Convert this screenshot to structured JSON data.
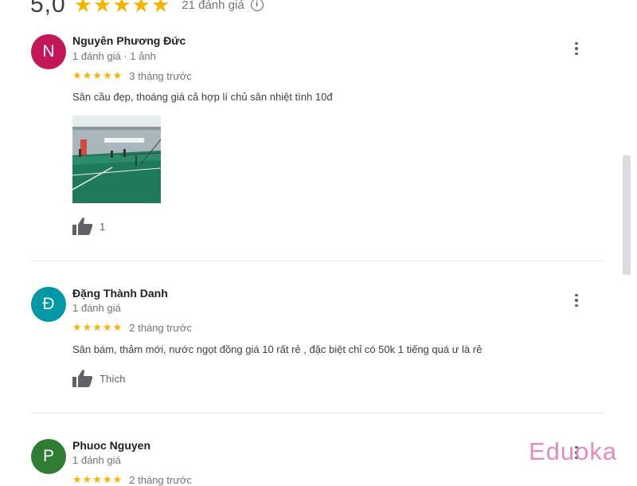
{
  "summary": {
    "rating": "5,0",
    "stars": "★★★★★",
    "count": "21 đánh giá",
    "info_icon": "i"
  },
  "reviews": [
    {
      "avatar_letter": "N",
      "avatar_color": "#c2185b",
      "name": "Nguyên Phương Đức",
      "meta": "1 đánh giá · 1 ảnh",
      "stars": "★★★★★",
      "time": "3 tháng trước",
      "text": "Sân cầu đẹp, thoáng giá cả hợp lí chủ sân nhiệt tình 10đ",
      "like_label": "1",
      "has_photo": true
    },
    {
      "avatar_letter": "Đ",
      "avatar_color": "#0097a7",
      "name": "Đặng Thành Danh",
      "meta": "1 đánh giá",
      "stars": "★★★★★",
      "time": "2 tháng trước",
      "text": "Sân bám, thảm mới, nước ngọt đồng giá 10 rất rẻ , đặc biệt chỉ có 50k 1 tiếng quá ư là rẻ",
      "like_label": "Thích",
      "has_photo": false
    },
    {
      "avatar_letter": "P",
      "avatar_color": "#2e7d32",
      "name": "Phuoc Nguyen",
      "meta": "1 đánh giá",
      "stars": "★★★★★",
      "time": "2 tháng trước",
      "has_photo": false
    }
  ],
  "watermark": "Eduoka",
  "colors": {
    "star": "#f5b400",
    "text_secondary": "#70757a",
    "divider": "#e8eaed"
  }
}
